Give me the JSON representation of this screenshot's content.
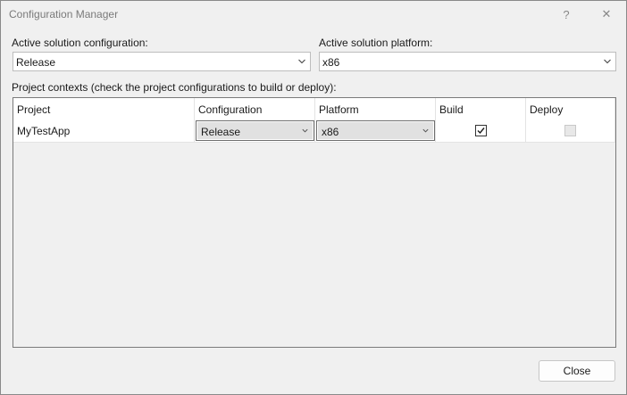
{
  "window": {
    "title": "Configuration Manager",
    "help_glyph": "?",
    "close_glyph": "✕"
  },
  "solution_configuration": {
    "label": "Active solution configuration:",
    "value": "Release"
  },
  "solution_platform": {
    "label": "Active solution platform:",
    "value": "x86"
  },
  "project_contexts": {
    "label": "Project contexts (check the project configurations to build or deploy):",
    "columns": {
      "project": "Project",
      "configuration": "Configuration",
      "platform": "Platform",
      "build": "Build",
      "deploy": "Deploy"
    },
    "rows": [
      {
        "project": "MyTestApp",
        "configuration": "Release",
        "platform": "x86",
        "build": true,
        "deploy": false,
        "deploy_enabled": false
      }
    ]
  },
  "footer": {
    "close_label": "Close"
  },
  "icons": {
    "chevron": "chevron-down-icon",
    "check": "checkmark-icon"
  }
}
